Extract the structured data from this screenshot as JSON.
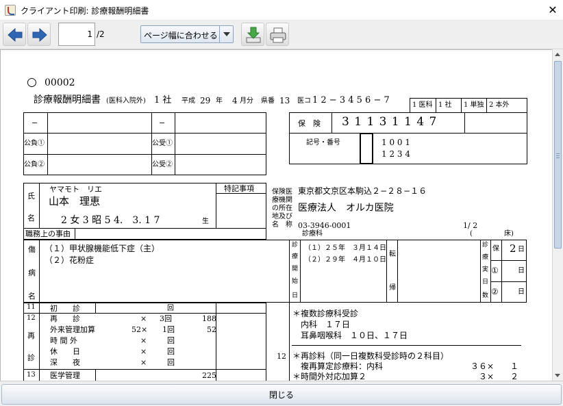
{
  "window": {
    "title": "クライアント印刷: 診療報酬明細書",
    "close_glyph": "✕"
  },
  "toolbar": {
    "prev_label": "previous-page",
    "next_label": "next-page",
    "page_current": "1",
    "page_total": "/2",
    "zoom_selected": "ページ幅に合わせる",
    "download_icon": "download-icon",
    "print_icon": "printer-icon"
  },
  "doc": {
    "header": {
      "circle": "○",
      "number": "00002",
      "title": "診療報酬明細書",
      "title_sub": "(医科入院外)",
      "kind": "1 社",
      "era_label": "平成",
      "year": "29",
      "year_unit": "年",
      "month": "4",
      "month_unit": "月分",
      "pref_label": "県番",
      "pref_no": "13",
      "med_code_label": "医コ",
      "med_code": "1 2 − 3 4 5 6 − 7"
    },
    "type_boxes": [
      "1 医科",
      "1 社",
      "1 単独",
      "2 本外"
    ],
    "kohi": {
      "dash": "−",
      "rows": [
        "公負①",
        "公負②"
      ],
      "rows2": [
        "公受①",
        "公受②"
      ]
    },
    "insurer": {
      "label": "保　険",
      "number": "3 1 1 3 1 1 4 7",
      "symbol_label": "記号・番号",
      "symbol": "1 0 0 1",
      "no": "1 2 3 4"
    },
    "patient": {
      "name_label_1": "氏",
      "name_label_2": "名",
      "kana": "ヤマモト　リエ",
      "name": "山本　理恵",
      "sex_birth": "2 女 3 昭 5 4.　3. 1 7",
      "birth_suffix": "生",
      "tokki": "特記事項",
      "job_reason": "職務上の事由"
    },
    "facility": {
      "label_lines": [
        "保険医",
        "療機関",
        "の所在",
        "地及び",
        "名　称"
      ],
      "address": "東京都文京区本駒込２−２８−１６",
      "name": "医療法人　オルカ医院",
      "tel": "03-3946-0001",
      "dept": "診療科",
      "page": "1/ 2",
      "bed_open": "(",
      "bed_close": "床)"
    },
    "disease": {
      "side_chars": [
        "傷",
        "病",
        "名"
      ],
      "names": [
        "（１）甲状腺機能低下症（主）",
        "（２）花粉症"
      ],
      "start_chars": [
        "診",
        "療",
        "開",
        "始",
        "日"
      ],
      "start_dates": [
        "（１）２５年　３月１４日",
        "（２）２９年　４月１０日"
      ],
      "tenki_chars": [
        "転",
        "帰"
      ],
      "days_chars": [
        "診",
        "療",
        "実",
        "日",
        "数"
      ],
      "ins_label": "保",
      "days_ins": "2",
      "day_unit": "日",
      "kohi1": "①",
      "kohi2": "②"
    },
    "fees": {
      "r11_no": "11",
      "r11_label": "初　　診",
      "r11_unit": "回",
      "r12_no": "12",
      "r12_side_1": "再",
      "r12_side_2": "診",
      "rows": [
        {
          "label": "再　　診",
          "mult": "×",
          "count": "3回",
          "pts": "188"
        },
        {
          "label": "外来管理加算",
          "mult": "52×",
          "count": "1回",
          "pts": "52"
        },
        {
          "label": "時 間 外",
          "mult": "×",
          "count": "回",
          "pts": ""
        },
        {
          "label": "休　　日",
          "mult": "×",
          "count": "回",
          "pts": ""
        },
        {
          "label": "深　　夜",
          "mult": "×",
          "count": "回",
          "pts": ""
        }
      ],
      "r13_no": "13",
      "r13_label": "医学管理",
      "r13_pts": "225"
    },
    "detail": {
      "col_no": "12",
      "lines_top": [
        "＊複数診療科受診",
        "　内科　１７日",
        "　耳鼻咽喉科　１０日、１７日"
      ],
      "line_1": "＊再診料（同一日複数科受診時の２科目）",
      "line_2": "　複再算定診療料：内科",
      "line_2_qty": "３６×　　１",
      "line_3": "＊時間外対応加算２",
      "line_3_qty": "３×　　２"
    }
  },
  "footer": {
    "close_label": "閉じる"
  }
}
